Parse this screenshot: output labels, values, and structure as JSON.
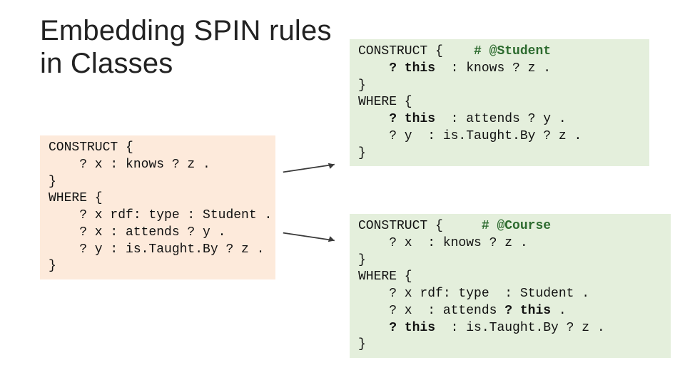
{
  "title_line1": "Embedding SPIN rules",
  "title_line2": "in Classes",
  "code_left": {
    "l1": "CONSTRUCT {",
    "l2": "    ? x : knows ? z .",
    "l3": "}",
    "l4": "WHERE {",
    "l5": "    ? x rdf: type : Student .",
    "l6": "    ? x : attends ? y .",
    "l7": "    ? y : is.Taught.By ? z .",
    "l8": "}"
  },
  "code_top": {
    "h1a": "CONSTRUCT {",
    "h1b": "# @Student",
    "l2a": "    ",
    "l2b": "? this",
    "l2c": "  : knows ? z .",
    "l3": "}",
    "l4": "WHERE {",
    "l5a": "    ",
    "l5b": "? this",
    "l5c": "  : attends ? y .",
    "l6": "    ? y  : is.Taught.By ? z .",
    "l7": "}"
  },
  "code_bot": {
    "h1a": "CONSTRUCT {",
    "h1b": "# @Course",
    "l2": "    ? x  : knows ? z .",
    "l3": "}",
    "l4": "WHERE {",
    "l5": "    ? x rdf: type  : Student .",
    "l6a": "    ? x  : attends ",
    "l6b": "? this",
    "l6c": " .",
    "l7a": "    ",
    "l7b": "? this",
    "l7c": "  : is.Taught.By ? z .",
    "l8": "}"
  }
}
